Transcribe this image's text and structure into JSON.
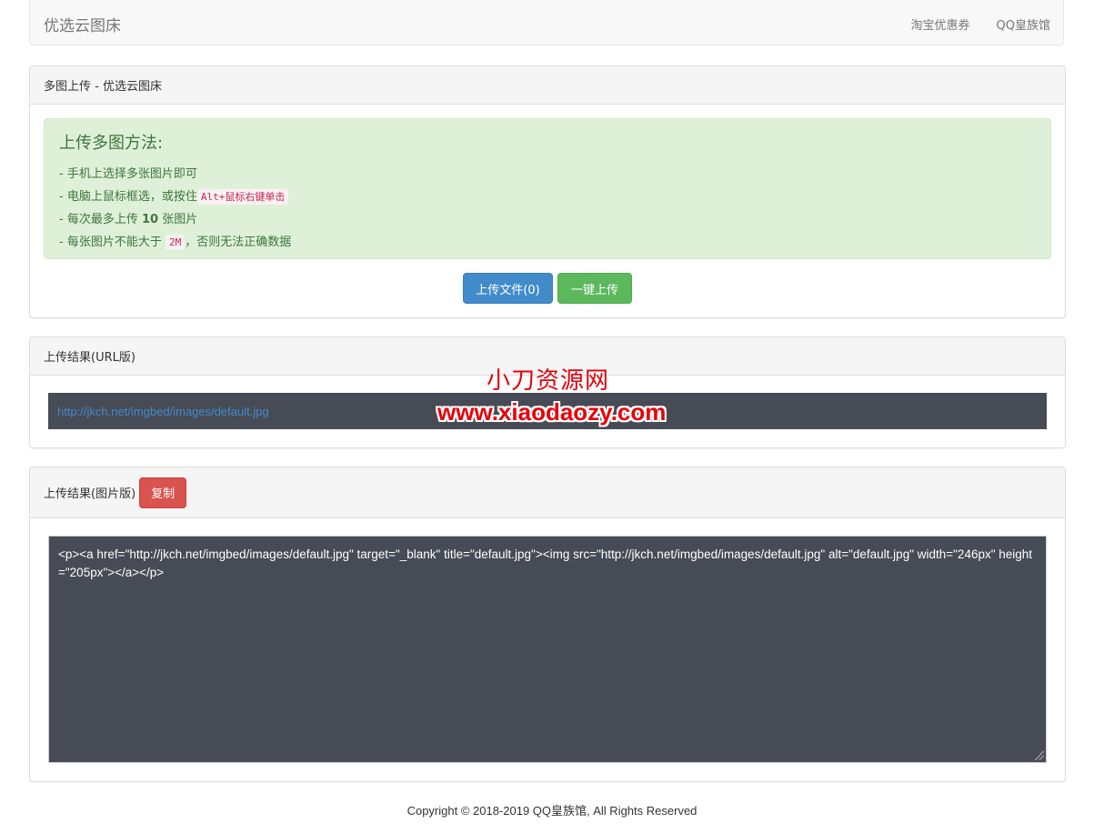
{
  "navbar": {
    "brand": "优选云图床",
    "links": [
      "淘宝优惠券",
      "QQ皇族馆"
    ]
  },
  "upload_panel": {
    "heading": "多图上传 - 优选云图床",
    "alert_title": "上传多图方法:",
    "line1": "- 手机上选择多张图片即可",
    "line2_prefix": "- 电脑上鼠标框选，或按住",
    "line2_code": "Alt+鼠标右键单击",
    "line3_prefix": "- 每次最多上传",
    "line3_bold": "10",
    "line3_suffix": "张图片",
    "line4_prefix": "- 每张图片不能大于",
    "line4_code": "2M",
    "line4_suffix": "，否则无法正确数据",
    "upload_button": "上传文件(0)",
    "submit_button": "一键上传"
  },
  "url_panel": {
    "heading": "上传结果(URL版)",
    "url": "http://jkch.net/imgbed/images/default.jpg"
  },
  "image_panel": {
    "heading": "上传结果(图片版)",
    "copy_button": "复制",
    "code": "<p><a href=\"http://jkch.net/imgbed/images/default.jpg\" target=\"_blank\" title=\"default.jpg\"><img src=\"http://jkch.net/imgbed/images/default.jpg\" alt=\"default.jpg\" width=\"246px\" height=\"205px\"></a></p>"
  },
  "watermark": {
    "line1": "小刀资源网",
    "line2": "www.xiaodaozy.com"
  },
  "footer": "Copyright © 2018-2019 QQ皇族馆, All Rights Reserved",
  "colors": {
    "primary": "#428bca",
    "success": "#5cb85c",
    "danger": "#d9534f",
    "alert_bg": "#dff0d8",
    "code_bg": "#474b55"
  }
}
